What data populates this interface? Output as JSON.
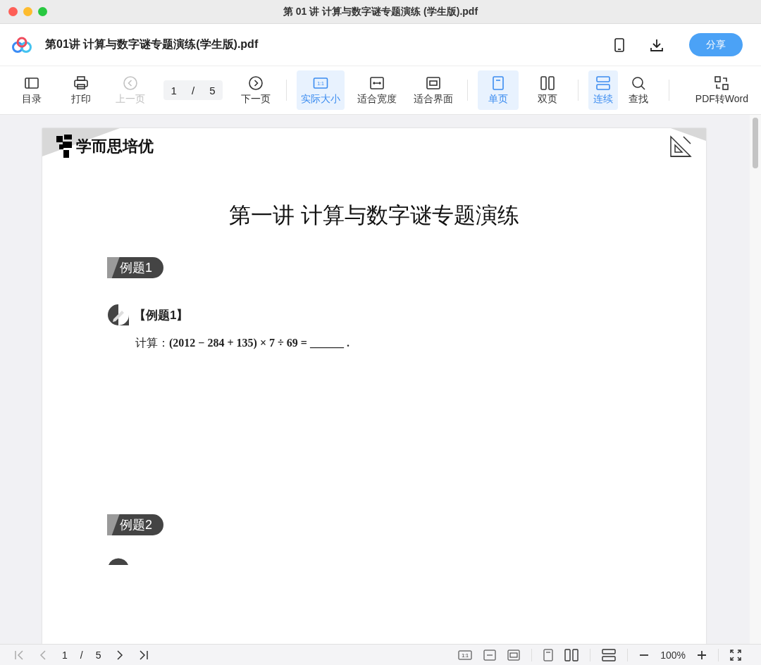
{
  "window": {
    "title": "第 01 讲 计算与数字谜专题演练 (学生版).pdf"
  },
  "header": {
    "file_name": "第01讲 计算与数字谜专题演练(学生版).pdf",
    "share_button": "分享"
  },
  "toolbar": [
    {
      "kind": "toc",
      "label": "目录",
      "selected": false,
      "disabled": false
    },
    {
      "kind": "print",
      "label": "打印",
      "selected": false,
      "disabled": false
    },
    {
      "kind": "prev",
      "label": "上一页",
      "selected": false,
      "disabled": true
    },
    {
      "kind": "page",
      "current": "1",
      "separator": "/",
      "total": "5"
    },
    {
      "kind": "next",
      "label": "下一页",
      "selected": false,
      "disabled": false
    },
    {
      "kind": "divider"
    },
    {
      "kind": "actual",
      "label": "实际大小",
      "icon_text": "1:1",
      "selected": true,
      "disabled": false
    },
    {
      "kind": "fitwidth",
      "label": "适合宽度",
      "selected": false,
      "disabled": false
    },
    {
      "kind": "fitpage",
      "label": "适合界面",
      "selected": false,
      "disabled": false
    },
    {
      "kind": "divider"
    },
    {
      "kind": "single",
      "label": "单页",
      "selected": true,
      "disabled": false
    },
    {
      "kind": "double",
      "label": "双页",
      "selected": false,
      "disabled": false
    },
    {
      "kind": "divider"
    },
    {
      "kind": "continuous",
      "label": "连续",
      "selected": true,
      "disabled": false
    },
    {
      "kind": "search",
      "label": "查找",
      "selected": false,
      "disabled": false
    },
    {
      "kind": "divider"
    },
    {
      "kind": "convert",
      "label": "PDF转Word",
      "selected": false,
      "disabled": false
    }
  ],
  "document": {
    "brand": "学而思培优",
    "title": "第一讲 计算与数字谜专题演练",
    "sections": [
      {
        "badge": "例题1",
        "problems": [
          {
            "heading": "【例题1】",
            "question": "计算：**(2012 − 284 + 135) × 7 ÷ 69 = ______  .**"
          }
        ]
      },
      {
        "badge": "例题2",
        "trailing_icon": true
      }
    ]
  },
  "status_bar": {
    "current": "1",
    "separator": "/",
    "total": "5",
    "icon_text": "1:1",
    "zoom": "100%"
  }
}
